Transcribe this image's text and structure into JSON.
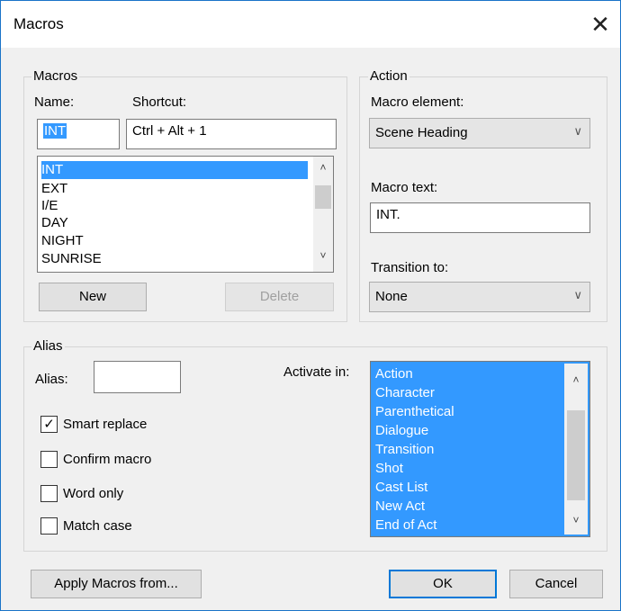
{
  "window": {
    "title": "Macros",
    "close_glyph": "✕"
  },
  "macros_group": {
    "label": "Macros",
    "name_label": "Name:",
    "shortcut_label": "Shortcut:",
    "name_value": "INT",
    "shortcut_value": "Ctrl + Alt + 1",
    "items": [
      "INT",
      "EXT",
      "I/E",
      "DAY",
      "NIGHT",
      "SUNRISE"
    ],
    "selected_index": 0,
    "new_button": "New",
    "delete_button": "Delete"
  },
  "action_group": {
    "label": "Action",
    "macro_element_label": "Macro element:",
    "macro_element_value": "Scene Heading",
    "macro_text_label": "Macro text:",
    "macro_text_value": "INT.",
    "transition_label": "Transition to:",
    "transition_value": "None"
  },
  "alias_group": {
    "label": "Alias",
    "alias_label": "Alias:",
    "alias_value": "",
    "activate_label": "Activate in:",
    "activate_items": [
      "Action",
      "Character",
      "Parenthetical",
      "Dialogue",
      "Transition",
      "Shot",
      "Cast List",
      "New Act",
      "End of Act"
    ],
    "checkboxes": [
      {
        "label": "Smart replace",
        "checked": true
      },
      {
        "label": "Confirm macro",
        "checked": false
      },
      {
        "label": "Word only",
        "checked": false
      },
      {
        "label": "Match case",
        "checked": false
      }
    ]
  },
  "footer": {
    "apply_button": "Apply Macros from...",
    "ok_button": "OK",
    "cancel_button": "Cancel"
  },
  "icons": {
    "close": "close-icon",
    "scroll_up": "scroll-up-icon",
    "scroll_down": "scroll-down-icon",
    "dropdown": "chevron-down-icon",
    "check": "checkmark-icon"
  }
}
